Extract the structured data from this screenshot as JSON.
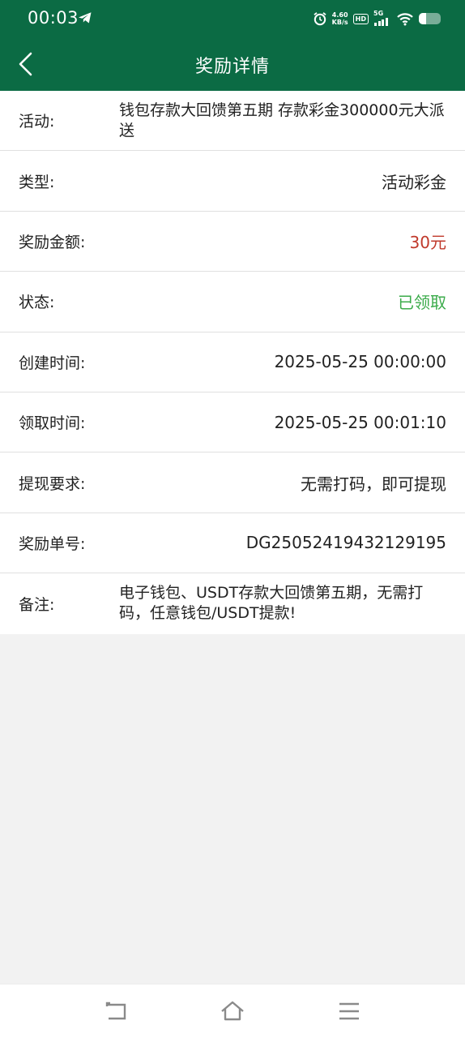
{
  "status_bar": {
    "time": "00:03",
    "net_speed_value": "4.60",
    "net_speed_unit": "KB/s",
    "hd_label": "HD",
    "network_label": "5G",
    "battery_level": 0.35
  },
  "header": {
    "title": "奖励详情"
  },
  "details": [
    {
      "label": "活动:",
      "value": "钱包存款大回馈第五期 存款彩金300000元大派送"
    },
    {
      "label": "类型:",
      "value": "活动彩金"
    },
    {
      "label": "奖励金额:",
      "value": "30元"
    },
    {
      "label": "状态:",
      "value": "已领取"
    },
    {
      "label": "创建时间:",
      "value": "2025-05-25 00:00:00"
    },
    {
      "label": "领取时间:",
      "value": "2025-05-25 00:01:10"
    },
    {
      "label": "提现要求:",
      "value": "无需打码，即可提现"
    },
    {
      "label": "奖励单号:",
      "value": "DG25052419432129195"
    },
    {
      "label": "备注:",
      "value": "电子钱包、USDT存款大回馈第五期，无需打码，任意钱包/USDT提款!"
    }
  ],
  "colors": {
    "header_bg": "#0b6b44",
    "amount": "#c0392b",
    "status_claimed": "#3bab4a",
    "page_bg": "#f2f2f2"
  },
  "icons": {
    "back": "chevron-left-icon",
    "nav_back": "nav-back-icon",
    "nav_home": "nav-home-icon",
    "nav_menu": "nav-menu-icon"
  }
}
